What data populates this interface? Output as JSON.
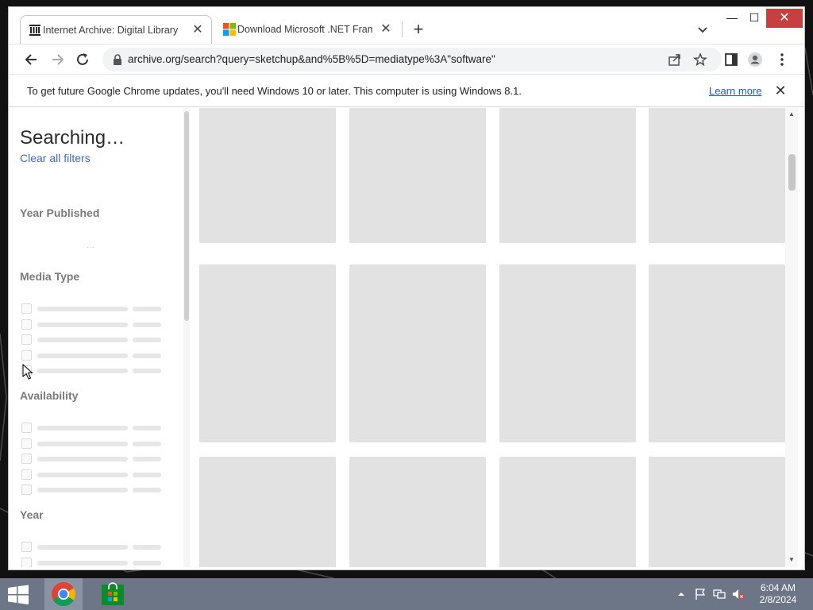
{
  "browser": {
    "tabs": [
      {
        "title": "Internet Archive: Digital Library of Free & Borrowable Books, Movies, Music & Wayback Machine",
        "active": true,
        "favicon": "archive-icon"
      },
      {
        "title": "Download Microsoft .NET Framework",
        "active": false,
        "favicon": "microsoft-icon"
      }
    ],
    "url": "archive.org/search?query=sketchup&and%5B%5D=mediatype%3A\"software\"",
    "infobar": {
      "message": "To get future Google Chrome updates, you'll need Windows 10 or later. This computer is using Windows 8.1.",
      "link_label": "Learn more"
    }
  },
  "page": {
    "heading": "Searching…",
    "clear_filters": "Clear all filters",
    "facets": [
      "Year Published",
      "Media Type",
      "Availability",
      "Year"
    ],
    "loading_dots": "…",
    "result_rows": 3,
    "result_cols": 4
  },
  "taskbar": {
    "time": "6:04 AM",
    "date": "2/8/2024"
  },
  "colors": {
    "link": "#4167c7",
    "tile_placeholder": "#e2e2e2",
    "taskbar": "#6d7687",
    "close_button": "#c74040"
  }
}
